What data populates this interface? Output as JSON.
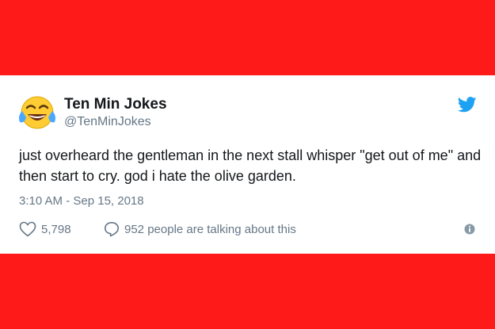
{
  "tweet": {
    "name": "Ten Min Jokes",
    "handle": "@TenMinJokes",
    "text": "just overheard the gentleman in the next stall whisper \"get out of me\" and then start to cry. god i hate the olive garden.",
    "timestamp": "3:10 AM - Sep 15, 2018",
    "likes": "5,798",
    "talking": "952 people are talking about this"
  },
  "icons": {
    "avatar": "face-with-tears-of-joy-emoji",
    "brand": "twitter-bird-icon",
    "like": "heart-icon",
    "reply": "speech-bubble-icon",
    "info": "info-icon"
  },
  "colors": {
    "background": "#ff1a1a",
    "card": "#ffffff",
    "brand": "#1da1f2",
    "text": "#14171a",
    "muted": "#657786"
  }
}
